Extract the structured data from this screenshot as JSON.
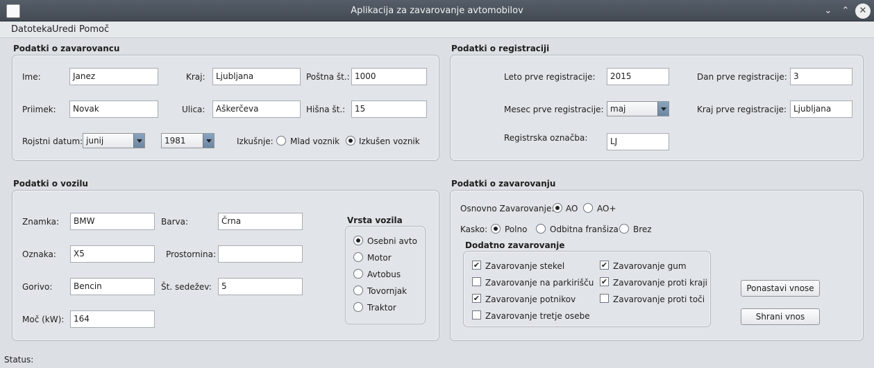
{
  "window": {
    "title": "Aplikacija za zavarovanje avtomobilov"
  },
  "menu": {
    "file": "Datoteka",
    "edit": "Uredi",
    "help": "Pomoč"
  },
  "insured": {
    "title": "Podatki o zavarovancu",
    "name_label": "Ime:",
    "name_value": "Janez",
    "surname_label": "Priimek:",
    "surname_value": "Novak",
    "place_label": "Kraj:",
    "place_value": "Ljubljana",
    "street_label": "Ulica:",
    "street_value": "Aškerčeva",
    "postal_label": "Poštna št.:",
    "postal_value": "1000",
    "house_label": "Hišna št.:",
    "house_value": "15",
    "birth_label": "Rojstni datum:",
    "birth_month": "junij",
    "birth_year": "1981",
    "experience_label": "Izkušnje:",
    "young_driver": "Mlad voznik",
    "experienced_driver": "Izkušen voznik",
    "experience_selected": "Izkušen voznik"
  },
  "registration": {
    "title": "Podatki o registraciji",
    "year_label": "Leto prve registracije:",
    "year_value": "2015",
    "day_label": "Dan prve registracije:",
    "day_value": "3",
    "month_label": "Mesec prve registracije:",
    "month_value": "maj",
    "place_label": "Kraj prve registracije:",
    "place_value": "Ljubljana",
    "mark_label": "Registrska označba:",
    "mark_value": "LJ"
  },
  "vehicle": {
    "title": "Podatki o vozilu",
    "brand_label": "Znamka:",
    "brand_value": "BMW",
    "color_label": "Barva:",
    "color_value": "Črna",
    "model_label": "Oznaka:",
    "model_value": "X5",
    "volume_label": "Prostornina:",
    "volume_value": "",
    "fuel_label": "Gorivo:",
    "fuel_value": "Bencin",
    "seats_label": "Št. sedežev:",
    "seats_value": "5",
    "power_label": "Moč (kW):",
    "power_value": "164",
    "type_title": "Vrsta vozila",
    "types": [
      "Osebni avto",
      "Motor",
      "Avtobus",
      "Tovornjak",
      "Traktor"
    ],
    "type_selected": "Osebni avto"
  },
  "insurance": {
    "title": "Podatki o zavarovanju",
    "basic_label": "Osnovno Zavarovanje:",
    "basic_options": [
      "AO",
      "AO+"
    ],
    "basic_selected": "AO",
    "kasko_label": "Kasko:",
    "kasko_options": [
      "Polno",
      "Odbitna franšiza",
      "Brez"
    ],
    "kasko_selected": "Polno",
    "additional_title": "Dodatno zavarovanje",
    "glass": {
      "label": "Zavarovanje stekel",
      "checked": true
    },
    "tires": {
      "label": "Zavarovanje gum",
      "checked": true
    },
    "parking": {
      "label": "Zavarovanje na parkirišču",
      "checked": false
    },
    "theft": {
      "label": "Zavarovanje proti kraji",
      "checked": true
    },
    "passengers": {
      "label": "Zavarovanje potnikov",
      "checked": true
    },
    "hail": {
      "label": "Zavarovanje proti toči",
      "checked": false
    },
    "third_party": {
      "label": "Zavarovanje tretje osebe",
      "checked": false
    },
    "reset_button": "Ponastavi vnose",
    "save_button": "Shrani vnos"
  },
  "status": {
    "label": "Status:",
    "text": ""
  }
}
